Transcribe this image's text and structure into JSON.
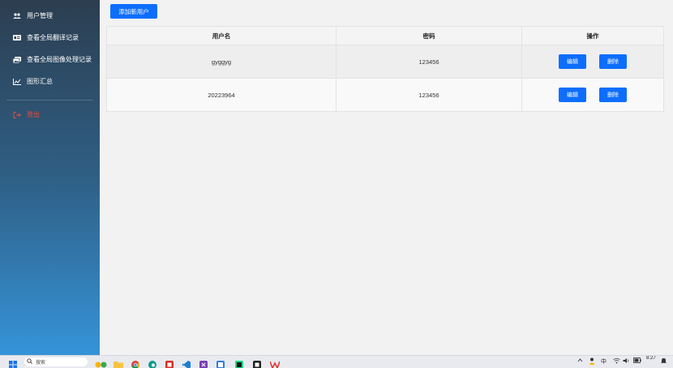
{
  "sidebar": {
    "items": [
      {
        "label": "用户管理",
        "icon": "users-icon"
      },
      {
        "label": "查看全局翻译记录",
        "icon": "id-card-icon"
      },
      {
        "label": "查看全局图像处理记录",
        "icon": "images-icon"
      },
      {
        "label": "图形汇总",
        "icon": "line-chart-icon"
      }
    ],
    "logout": {
      "label": "登出",
      "icon": "sign-out-icon",
      "color": "#e74c3c"
    }
  },
  "main": {
    "add_button_label": "添加新用户",
    "table": {
      "headers": [
        "用户名",
        "密码",
        "操作"
      ],
      "rows": [
        {
          "username": "gyggyg",
          "password": "123456",
          "edit": "编辑",
          "delete": "删除"
        },
        {
          "username": "20223964",
          "password": "123456",
          "edit": "编辑",
          "delete": "删除"
        }
      ]
    }
  },
  "taskbar": {
    "search_placeholder": "搜索",
    "ime_label": "中",
    "clock": "8:27"
  },
  "colors": {
    "primary": "#0d6efd",
    "sidebar_top": "#2c3e50",
    "sidebar_bottom": "#3593d8",
    "logout": "#e74c3c"
  }
}
